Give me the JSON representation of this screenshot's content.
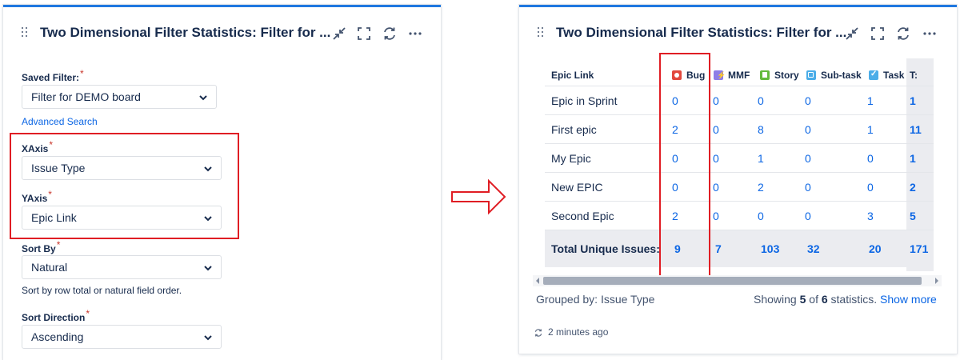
{
  "left": {
    "title": "Two Dimensional Filter Statistics: Filter for ...",
    "saved_filter": {
      "label": "Saved Filter:",
      "required": "*",
      "value": "Filter for DEMO board"
    },
    "advanced_search": "Advanced Search",
    "xaxis": {
      "label": "XAxis",
      "required": "*",
      "value": "Issue Type"
    },
    "yaxis": {
      "label": "YAxis",
      "required": "*",
      "value": "Epic Link"
    },
    "sort_by": {
      "label": "Sort By",
      "required": "*",
      "value": "Natural",
      "help": "Sort by row total or natural field order."
    },
    "sort_direction": {
      "label": "Sort Direction",
      "required": "*",
      "value": "Ascending"
    }
  },
  "right": {
    "title": "Two Dimensional Filter Statistics: Filter for ...",
    "table": {
      "row_header": "Epic Link",
      "columns": [
        {
          "label": "Bug",
          "icon": "bug-icon",
          "color": "#e2483d"
        },
        {
          "label": "MMF",
          "icon": "mmf-icon",
          "color": "#8f7ee7"
        },
        {
          "label": "Story",
          "icon": "story-icon",
          "color": "#63ba3c"
        },
        {
          "label": "Sub-task",
          "icon": "subtask-icon",
          "color": "#4bade8"
        },
        {
          "label": "Task",
          "icon": "task-icon",
          "color": "#4bade8"
        },
        {
          "label": "T:",
          "icon": "",
          "color": ""
        }
      ],
      "rows": [
        {
          "label": "Epic in Sprint",
          "values": [
            "0",
            "0",
            "0",
            "0",
            "1"
          ],
          "total": "1"
        },
        {
          "label": "First epic",
          "values": [
            "2",
            "0",
            "8",
            "0",
            "1"
          ],
          "total": "11"
        },
        {
          "label": "My Epic",
          "values": [
            "0",
            "0",
            "1",
            "0",
            "0"
          ],
          "total": "1"
        },
        {
          "label": "New EPIC",
          "values": [
            "0",
            "0",
            "2",
            "0",
            "0"
          ],
          "total": "2"
        },
        {
          "label": "Second Epic",
          "values": [
            "2",
            "0",
            "0",
            "0",
            "3"
          ],
          "total": "5"
        }
      ],
      "totals": {
        "label": "Total Unique Issues:",
        "values": [
          "9",
          "7",
          "103",
          "32",
          "20"
        ],
        "total": "171"
      }
    },
    "grouped_by": "Grouped by: Issue Type",
    "showing": {
      "prefix": "Showing ",
      "shown": "5",
      "of": " of ",
      "total": "6",
      "suffix": " statistics. ",
      "link": "Show more"
    },
    "updated": "2 minutes ago"
  },
  "colors": {
    "accent": "#1f78e0",
    "link": "#0c66e4",
    "annotation": "#e01d24"
  }
}
